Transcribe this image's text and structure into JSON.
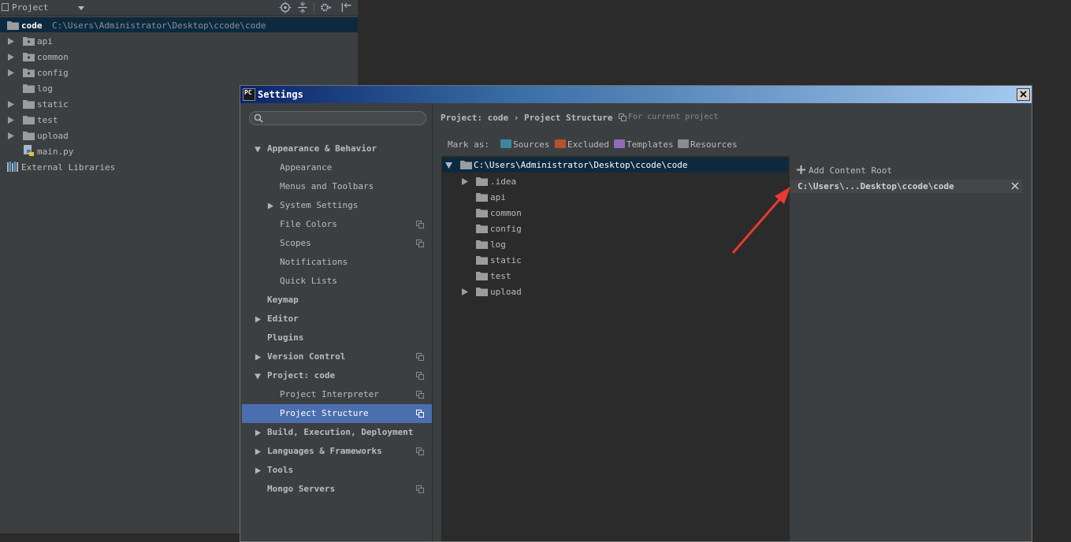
{
  "project_panel": {
    "header_label": "Project",
    "root": {
      "name": "code",
      "path": "C:\\Users\\Administrator\\Desktop\\ccode\\code"
    },
    "items": [
      {
        "label": "api",
        "expandable": true
      },
      {
        "label": "common",
        "expandable": true
      },
      {
        "label": "config",
        "expandable": true
      },
      {
        "label": "log",
        "expandable": false
      },
      {
        "label": "static",
        "expandable": true
      },
      {
        "label": "test",
        "expandable": true
      },
      {
        "label": "upload",
        "expandable": true
      },
      {
        "label": "main.py",
        "expandable": false
      },
      {
        "label": "External Libraries",
        "expandable": false
      }
    ]
  },
  "dialog": {
    "title": "Settings",
    "logo_text": "PC",
    "nav": [
      {
        "label": "Appearance & Behavior",
        "bold": true,
        "arrow": "down"
      },
      {
        "label": "Appearance"
      },
      {
        "label": "Menus and Toolbars"
      },
      {
        "label": "System Settings",
        "arrow": "right"
      },
      {
        "label": "File Colors",
        "copy": true
      },
      {
        "label": "Scopes",
        "copy": true
      },
      {
        "label": "Notifications"
      },
      {
        "label": "Quick Lists"
      },
      {
        "label": "Keymap",
        "bold": true
      },
      {
        "label": "Editor",
        "bold": true,
        "arrow": "right"
      },
      {
        "label": "Plugins",
        "bold": true
      },
      {
        "label": "Version Control",
        "bold": true,
        "arrow": "right",
        "copy": true
      },
      {
        "label": "Project: code",
        "bold": true,
        "arrow": "down",
        "copy": true
      },
      {
        "label": "Project Interpreter",
        "copy": true
      },
      {
        "label": "Project Structure",
        "copy": true,
        "selected": true
      },
      {
        "label": "Build, Execution, Deployment",
        "bold": true,
        "arrow": "right"
      },
      {
        "label": "Languages & Frameworks",
        "bold": true,
        "arrow": "right",
        "copy": true
      },
      {
        "label": "Tools",
        "bold": true,
        "arrow": "right"
      },
      {
        "label": "Mongo Servers",
        "bold": true,
        "copy": true
      }
    ],
    "breadcrumb": "Project: code › Project Structure",
    "breadcrumb_note": "For current project",
    "mark_as_label": "Mark as:",
    "mark_as": [
      {
        "label": "Sources",
        "color": "#3e86a0"
      },
      {
        "label": "Excluded",
        "color": "#b2532a"
      },
      {
        "label": "Templates",
        "color": "#8f6db6"
      },
      {
        "label": "Resources",
        "color": "#8c8c8c"
      }
    ],
    "content_tree": {
      "root_path": "C:\\Users\\Administrator\\Desktop\\ccode\\code",
      "children": [
        {
          "label": ".idea",
          "expandable": true
        },
        {
          "label": "api"
        },
        {
          "label": "common"
        },
        {
          "label": "config"
        },
        {
          "label": "log"
        },
        {
          "label": "static"
        },
        {
          "label": "test"
        },
        {
          "label": "upload",
          "expandable": true
        }
      ]
    },
    "add_content_root_label": "Add Content Root",
    "content_root_entry": "C:\\Users\\...Desktop\\ccode\\code"
  },
  "colors": {
    "selection": "#4b6eaf",
    "tree_selection": "#0d293e",
    "annotation_arrow": "#e83a30",
    "folder": "#9a9d9f"
  }
}
